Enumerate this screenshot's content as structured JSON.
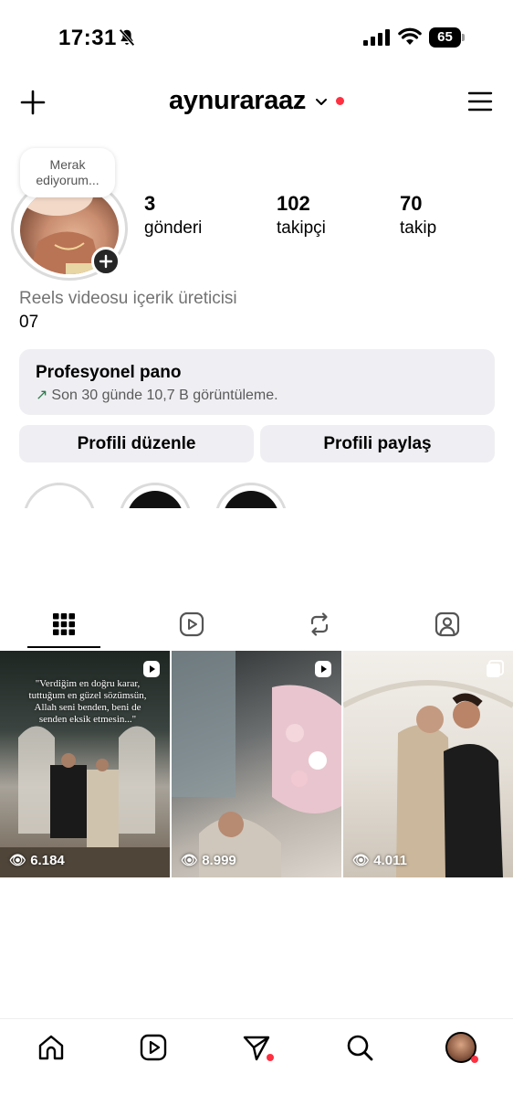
{
  "status_bar": {
    "time": "17:31",
    "battery": "65"
  },
  "header": {
    "username": "aynuraraaz"
  },
  "profile": {
    "note": "Merak ediyorum...",
    "stats": [
      {
        "value": "3",
        "label": "gönderi"
      },
      {
        "value": "102",
        "label": "takipçi"
      },
      {
        "value": "70",
        "label": "takip"
      }
    ],
    "category": "Reels videosu içerik üreticisi",
    "bio": "07"
  },
  "pro_dashboard": {
    "title": "Profesyonel pano",
    "subtitle": "Son 30 günde 10,7 B görüntüleme."
  },
  "buttons": {
    "edit_profile": "Profili düzenle",
    "share_profile": "Profili paylaş"
  },
  "tabs": [
    "grid-icon",
    "reels-icon",
    "reposts-icon",
    "tagged-icon"
  ],
  "posts": [
    {
      "views": "6.184",
      "caption": "\"Verdiğim en doğru karar, tuttuğum en güzel sözümsün, Allah seni benden, beni de senden eksik etmesin...\""
    },
    {
      "views": "8.999",
      "caption": ""
    },
    {
      "views": "4.011",
      "caption": ""
    }
  ],
  "colors": {
    "notification_red": "#ff3040",
    "panel_bg": "#efeff3",
    "muted_text": "#737373"
  }
}
